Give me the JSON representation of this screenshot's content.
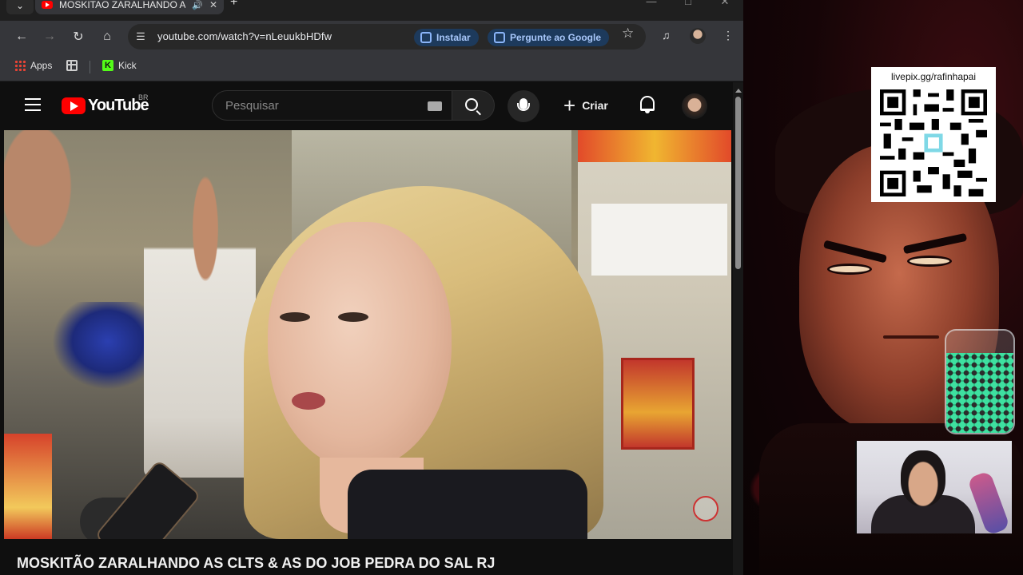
{
  "browser": {
    "tab": {
      "title": "MOSKITAO ZARALHANDO A",
      "audio_icon": "speaker-icon",
      "close_icon": "close-icon"
    },
    "window_controls": [
      "minimize",
      "maximize",
      "close"
    ],
    "toolbar": {
      "url": "youtube.com/watch?v=nLeuukbHDfw",
      "install_label": "Instalar",
      "ask_google_label": "Pergunte ao Google"
    },
    "bookmarks": [
      {
        "label": "Apps",
        "icon": "apps-grid-icon"
      },
      {
        "label": "",
        "icon": "grid-icon"
      },
      {
        "label": "Kick",
        "icon": "kick-logo"
      }
    ]
  },
  "youtube": {
    "logo_text": "YouTube",
    "region": "BR",
    "search_placeholder": "Pesquisar",
    "create_label": "Criar",
    "video_title": "MOSKITÃO ZARALHANDO AS CLTS & AS DO JOB PEDRA DO SAL RJ"
  },
  "overlay": {
    "qr_label": "livepix.gg/rafinhapai",
    "accent_color": "#8b1420"
  }
}
